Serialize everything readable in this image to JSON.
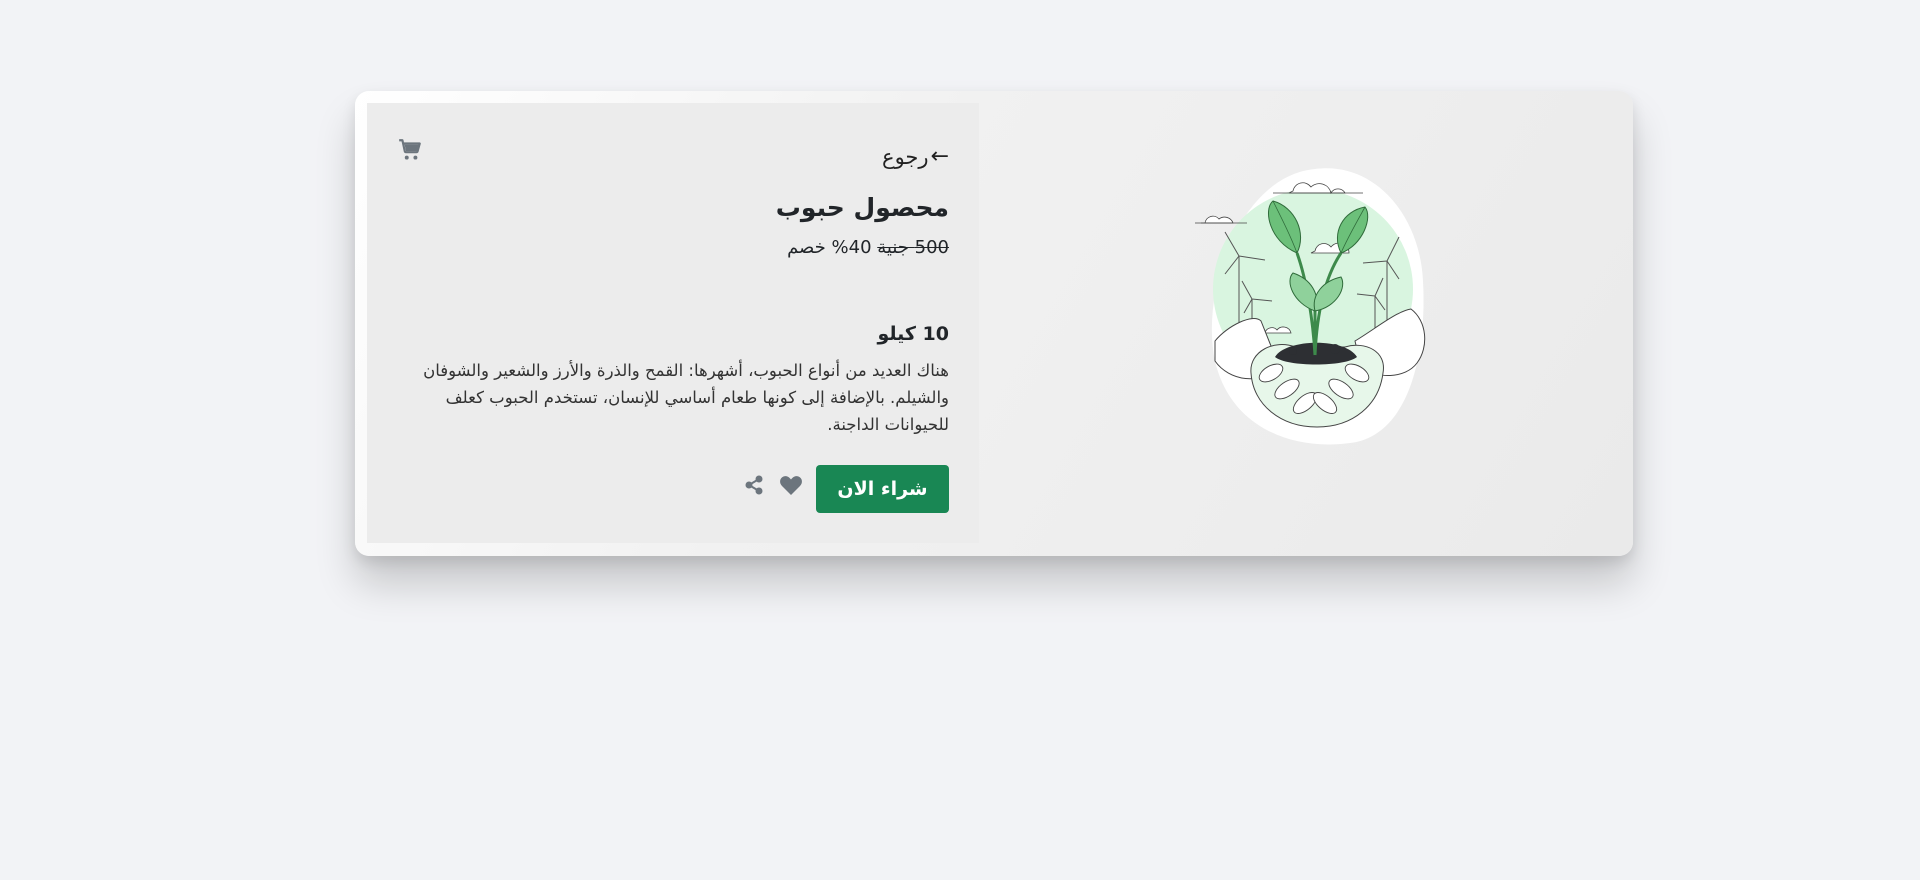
{
  "product": {
    "back_label": "رجوع",
    "back_arrow": "←",
    "title": "محصول حبوب",
    "old_price": "500 جنية",
    "discount": "40% خصم",
    "weight": "10 كيلو",
    "description": "هناك العديد من أنواع الحبوب، أشهرها: القمح والذرة والأرز والشعير والشوفان والشيلم. بالإضافة إلى كونها طعام أساسي للإنسان، تستخدم الحبوب كعلف للحيوانات الداجنة.",
    "buy_label": "شراء الان"
  },
  "icons": {
    "cart": "cart-icon",
    "heart": "heart-icon",
    "share": "share-icon",
    "illustration": "hands-holding-plant-illustration"
  },
  "colors": {
    "accent": "#198754",
    "icon": "#6c757d",
    "plant_green": "#6cc07a",
    "blob_green": "#d9f5e0"
  }
}
